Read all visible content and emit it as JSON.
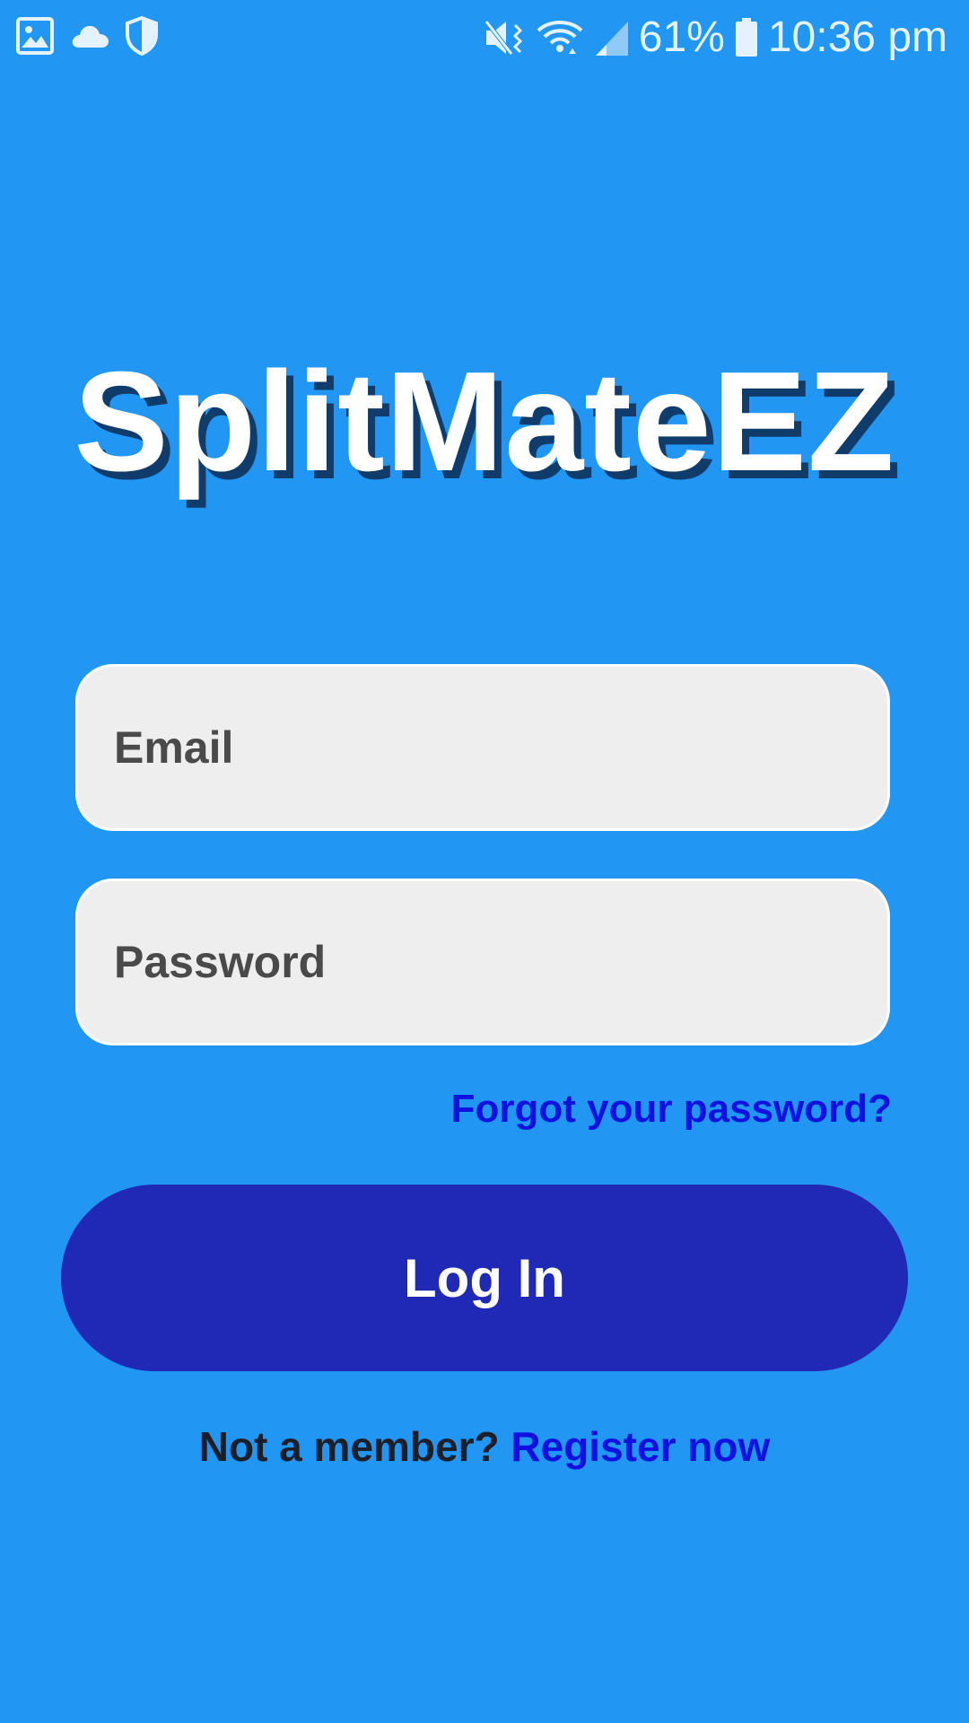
{
  "status_bar": {
    "left_icons": [
      "image-icon",
      "cloud-icon",
      "shield-icon"
    ],
    "right_icons": [
      "vibrate-icon",
      "wifi-icon",
      "signal-icon",
      "battery-icon"
    ],
    "battery_percent": "61%",
    "time": "10:36 pm"
  },
  "app": {
    "title": "SplitMateEZ"
  },
  "login_form": {
    "email_placeholder": "Email",
    "password_placeholder": "Password",
    "forgot_password_label": "Forgot your password?",
    "login_button_label": "Log In",
    "register_prompt": "Not a member?",
    "register_link_label": "Register now"
  },
  "colors": {
    "background": "#2196f3",
    "button": "#1f29b5",
    "link": "#1010e0",
    "field": "#eeeeee",
    "title": "#ffffff"
  }
}
